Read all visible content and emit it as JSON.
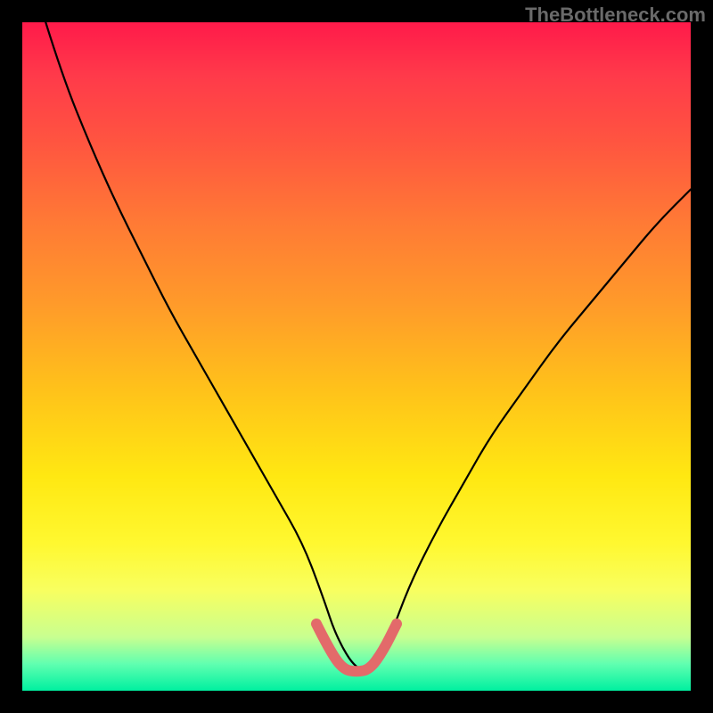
{
  "watermark": "TheBottleneck.com",
  "chart_data": {
    "type": "line",
    "title": "",
    "xlabel": "",
    "ylabel": "",
    "xlim": [
      0,
      100
    ],
    "ylim": [
      0,
      100
    ],
    "series": [
      {
        "name": "bottleneck-curve",
        "x": [
          3.5,
          6,
          10,
          14,
          18,
          22,
          26,
          30,
          34,
          38,
          42,
          45,
          47,
          50,
          53,
          55,
          58,
          62,
          66,
          70,
          75,
          80,
          85,
          90,
          95,
          100
        ],
        "values": [
          100,
          92,
          82,
          73,
          65,
          57,
          50,
          43,
          36,
          29,
          22,
          14,
          8,
          3,
          3,
          8,
          16,
          24,
          31,
          38,
          45,
          52,
          58,
          64,
          70,
          75
        ]
      }
    ],
    "highlight": {
      "name": "optimal-range",
      "x": [
        44,
        46,
        48,
        50,
        52,
        54,
        56
      ],
      "values": [
        10,
        6,
        3.2,
        2.8,
        3.2,
        6,
        10
      ],
      "color": "#e36a6a"
    },
    "gradient_stops": [
      {
        "pos": 0,
        "color": "#ff1a4a"
      },
      {
        "pos": 50,
        "color": "#ffd21a"
      },
      {
        "pos": 100,
        "color": "#00f0a0"
      }
    ]
  }
}
